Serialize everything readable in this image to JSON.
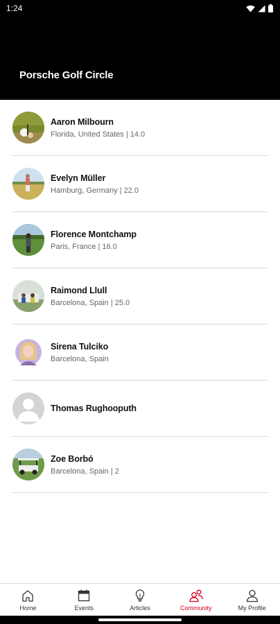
{
  "status_bar": {
    "time": "1:24",
    "icons": [
      "wifi-icon",
      "signal-icon",
      "battery-icon"
    ]
  },
  "header": {
    "title": "Porsche Golf Circle"
  },
  "members": [
    {
      "name": "Aaron Milbourn",
      "meta": "Florida, United States | 14.0",
      "avatar": "photo-golf-ball"
    },
    {
      "name": "Evelyn Müller",
      "meta": "Hamburg, Germany | 22.0",
      "avatar": "photo-golfer-swing"
    },
    {
      "name": "Florence Montchamp",
      "meta": "Paris, France | 16.0",
      "avatar": "photo-golfer-green"
    },
    {
      "name": "Raimond Llull",
      "meta": "Barcelona, Spain | 25.0",
      "avatar": "photo-golf-cart-people"
    },
    {
      "name": "Sirena Tulciko",
      "meta": "Barcelona, Spain",
      "avatar": "photo-portrait-woman"
    },
    {
      "name": "Thomas Rughooputh",
      "meta": "",
      "avatar": "default-person"
    },
    {
      "name": "Zoe Borbó",
      "meta": "Barcelona, Spain | 2",
      "avatar": "photo-golf-cart"
    }
  ],
  "bottom_nav": {
    "items": [
      {
        "label": "Home",
        "icon": "home-icon",
        "active": false
      },
      {
        "label": "Events",
        "icon": "calendar-icon",
        "active": false
      },
      {
        "label": "Articles",
        "icon": "lightbulb-icon",
        "active": false
      },
      {
        "label": "Community",
        "icon": "community-icon",
        "active": true
      },
      {
        "label": "My Profile",
        "icon": "person-icon",
        "active": false
      }
    ]
  },
  "colors": {
    "header_bg": "#000000",
    "accent": "#d5001c",
    "divider": "#d9d9d9"
  }
}
